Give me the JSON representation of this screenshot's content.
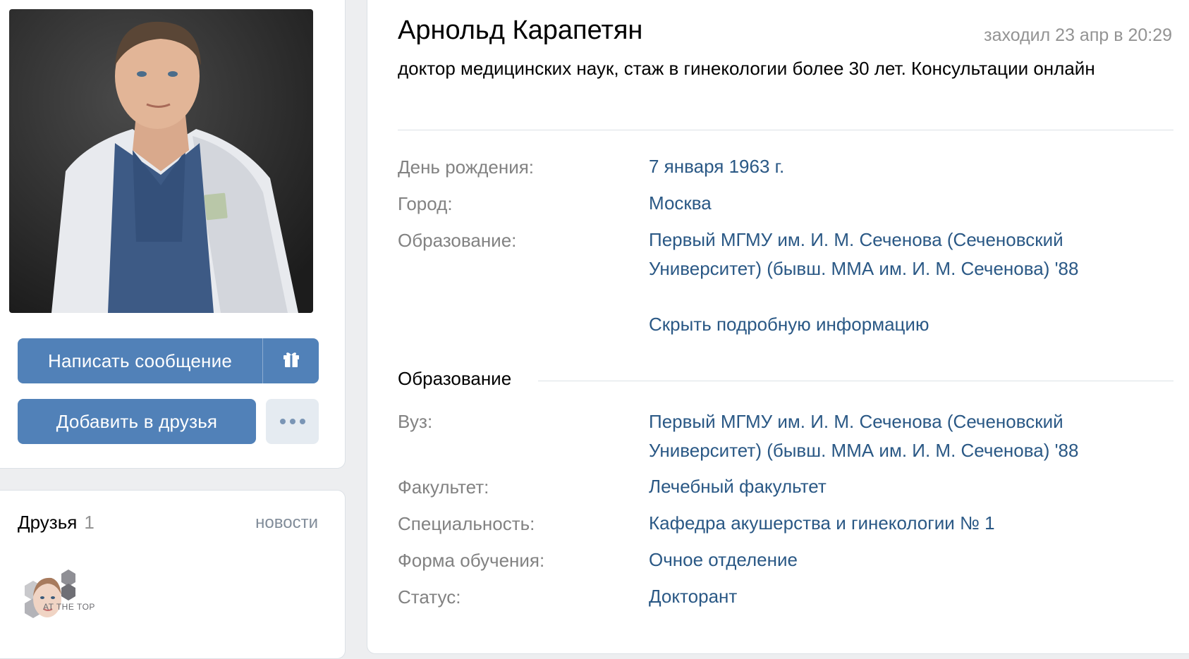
{
  "profile": {
    "name": "Арнольд Карапетян",
    "last_seen": "заходил 23 апр в 20:29",
    "status": "доктор медицинских наук, стаж в гинекологии более 30 лет. Консультации онлайн"
  },
  "actions": {
    "message_label": "Написать сообщение",
    "gift_icon": "gift-icon",
    "add_friend_label": "Добавить в друзья",
    "more_icon": "more-dots-icon"
  },
  "info": {
    "birthday_label": "День рождения:",
    "birthday_value": "7 января 1963 г.",
    "city_label": "Город:",
    "city_value": "Москва",
    "education_label": "Образование:",
    "education_value_line1": "Первый МГМУ им. И. М. Сеченова (Сеченовский",
    "education_value_line2": "Университет) (бывш. ММА им. И. М. Сеченова) '88",
    "hide_details": "Скрыть подробную информацию"
  },
  "education_section": {
    "title": "Образование",
    "university_label": "Вуз:",
    "university_value_line1": "Первый МГМУ им. И. М. Сеченова (Сеченовский",
    "university_value_line2": "Университет) (бывш. ММА им. И. М. Сеченова) '88",
    "faculty_label": "Факультет:",
    "faculty_value": "Лечебный факультет",
    "specialty_label": "Специальность:",
    "specialty_value": "Кафедра акушерства и гинекологии № 1",
    "study_form_label": "Форма обучения:",
    "study_form_value": "Очное отделение",
    "status_label": "Статус:",
    "status_value": "Докторант"
  },
  "friends": {
    "title": "Друзья",
    "count": "1",
    "news_link": "новости",
    "friend_avatar_text": "AT THE TOP"
  },
  "colors": {
    "background": "#edeef0",
    "button_primary": "#5181b8",
    "link": "#2a5885",
    "label_gray": "#828282"
  }
}
